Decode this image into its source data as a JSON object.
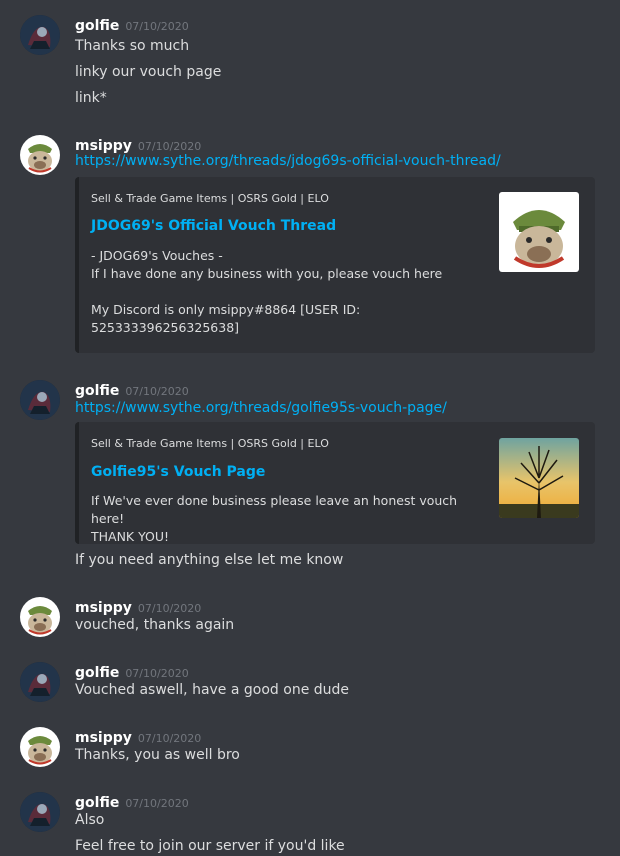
{
  "messages": [
    {
      "user": "golfie",
      "time": "07/10/2020",
      "lines": [
        "Thanks so much",
        "linky our vouch page",
        "link*"
      ]
    },
    {
      "user": "msippy",
      "time": "07/10/2020",
      "link": "https://www.sythe.org/threads/jdog69s-official-vouch-thread/",
      "embed": {
        "provider": "Sell & Trade Game Items | OSRS Gold | ELO",
        "title": "JDOG69's Official Vouch Thread",
        "description": "- JDOG69's Vouches -\nIf I have done any business with you, please vouch here\n\nMy Discord is only msippy#8864 [USER ID:\n525333396256325638]"
      }
    },
    {
      "user": "golfie",
      "time": "07/10/2020",
      "link": "https://www.sythe.org/threads/golfie95s-vouch-page/",
      "embed": {
        "provider": "Sell & Trade Game Items | OSRS Gold | ELO",
        "title": "Golfie95's Vouch Page",
        "description": "If We've ever done business please leave an honest vouch here!\nTHANK YOU!"
      },
      "after": "If you need anything else let me know"
    },
    {
      "user": "msippy",
      "time": "07/10/2020",
      "lines": [
        "vouched, thanks again"
      ]
    },
    {
      "user": "golfie",
      "time": "07/10/2020",
      "lines": [
        "Vouched aswell, have a good one dude"
      ]
    },
    {
      "user": "msippy",
      "time": "07/10/2020",
      "lines": [
        "Thanks, you as well bro"
      ]
    },
    {
      "user": "golfie",
      "time": "07/10/2020",
      "lines": [
        "Also",
        "Feel free to join our server if you'd like"
      ]
    }
  ]
}
